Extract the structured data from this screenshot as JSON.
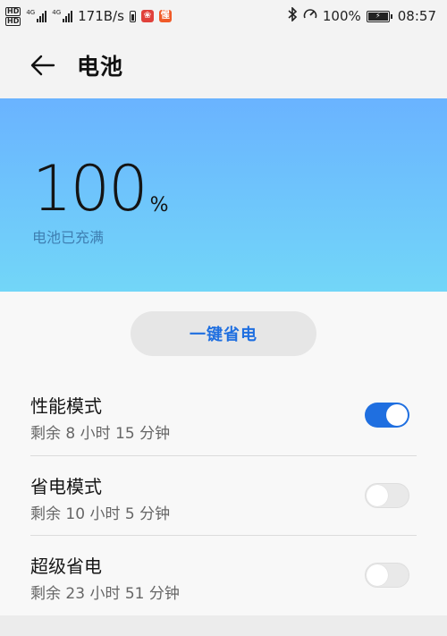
{
  "status_bar": {
    "hd1": "HD",
    "hd2": "HD",
    "sim1_tag": "4G",
    "sim2_tag": "4G",
    "net_speed": "171B/s",
    "battery_percent": "100%",
    "time": "08:57",
    "app_badge_1": "❀",
    "app_badge_2": "惺"
  },
  "header": {
    "title": "电池"
  },
  "battery": {
    "level": "100",
    "unit": "%",
    "status": "电池已充满",
    "gradient_top": "#6ab3ff",
    "gradient_bottom": "#72d6f8"
  },
  "save_button": {
    "label": "一键省电",
    "color": "#1f6fe0"
  },
  "modes": [
    {
      "name": "性能模式",
      "remaining": "剩余 8 小时 15 分钟",
      "enabled": true
    },
    {
      "name": "省电模式",
      "remaining": "剩余 10 小时 5 分钟",
      "enabled": false
    },
    {
      "name": "超级省电",
      "remaining": "剩余 23 小时 51 分钟",
      "enabled": false
    }
  ]
}
